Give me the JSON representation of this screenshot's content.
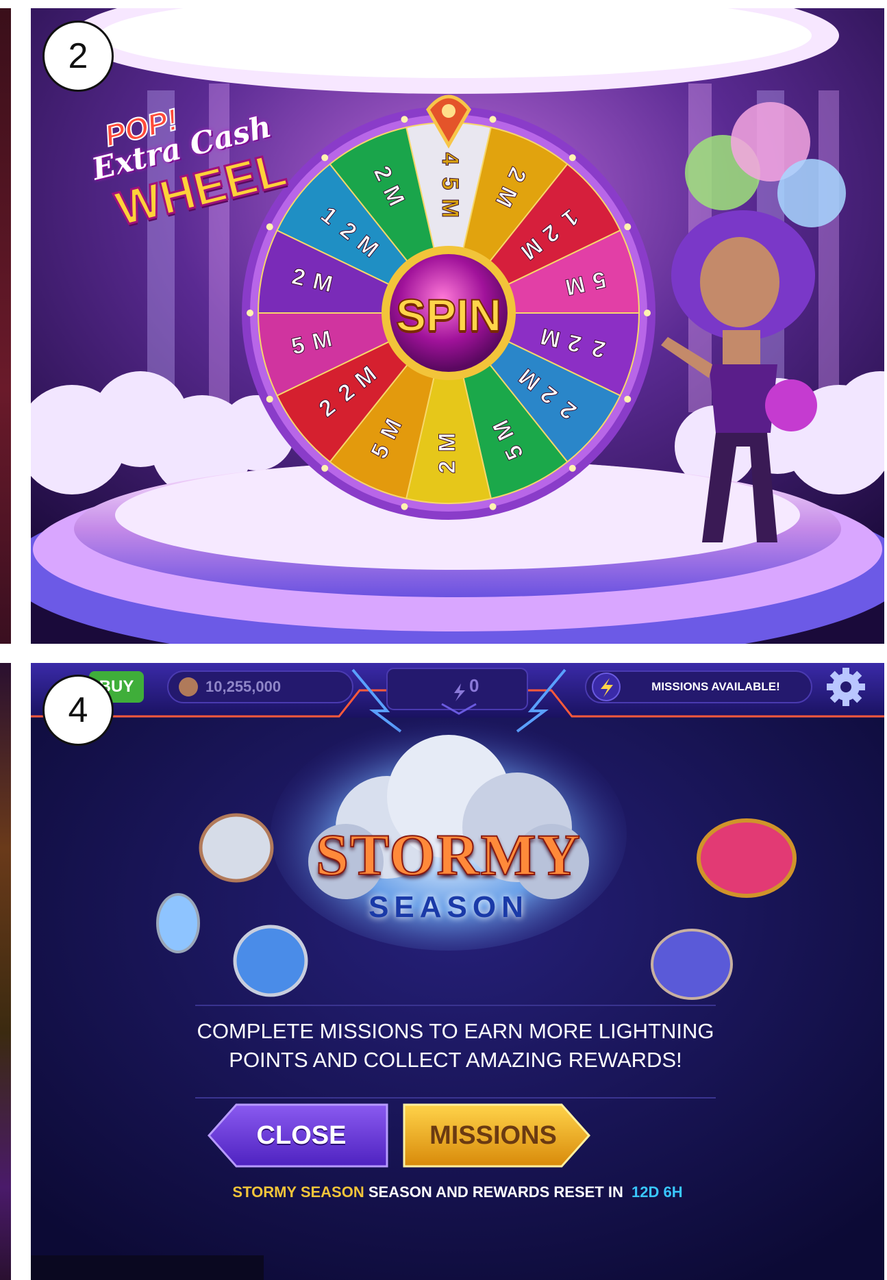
{
  "steps": {
    "top": "2",
    "bottom": "4"
  },
  "wheel_screen": {
    "logo": {
      "pop": "POP!",
      "extra_cash": "Extra Cash",
      "wheel": "WHEEL"
    },
    "spin_label": "SPIN",
    "segments": [
      {
        "label": "4\n5\nM",
        "color": "#e9e7f0",
        "text_color": "#d6a011"
      },
      {
        "label": "2\nM",
        "color": "#e1a30e",
        "text_color": "#ffffff"
      },
      {
        "label": "1\n2\nM",
        "color": "#d61f3c",
        "text_color": "#ffffff"
      },
      {
        "label": "5\nM",
        "color": "#e23fa6",
        "text_color": "#ffffff"
      },
      {
        "label": "2\n2\nM",
        "color": "#8c2fc5",
        "text_color": "#ffffff"
      },
      {
        "label": "2\n2\nM",
        "color": "#2a86c9",
        "text_color": "#ffffff"
      },
      {
        "label": "5\nM",
        "color": "#1ba84a",
        "text_color": "#ffffff"
      },
      {
        "label": "2\nM",
        "color": "#e6c71a",
        "text_color": "#ffffff"
      },
      {
        "label": "5\nM",
        "color": "#e39a0d",
        "text_color": "#ffffff"
      },
      {
        "label": "2\n2\nM",
        "color": "#d5202f",
        "text_color": "#ffffff"
      },
      {
        "label": "5\nM",
        "color": "#d0349f",
        "text_color": "#ffffff"
      },
      {
        "label": "2\nM",
        "color": "#7a2bb8",
        "text_color": "#ffffff"
      },
      {
        "label": "1\n2\nM",
        "color": "#1f8fc4",
        "text_color": "#ffffff"
      },
      {
        "label": "2\nM",
        "color": "#1aa54b",
        "text_color": "#ffffff"
      }
    ]
  },
  "missions_screen": {
    "topbar": {
      "buy_label": "BUY",
      "coin_balance": "10,255,000",
      "lightning_count": "0",
      "missions_available": "MISSIONS AVAILABLE!"
    },
    "title": {
      "line1": "STORMY",
      "line2": "SEASON"
    },
    "description": {
      "line1": "COMPLETE MISSIONS TO EARN MORE LIGHTNING",
      "line2": "POINTS AND COLLECT AMAZING REWARDS!"
    },
    "close_label": "CLOSE",
    "missions_label": "MISSIONS",
    "footer": {
      "season_name": "STORMY SEASON",
      "middle": "SEASON AND REWARDS RESET IN",
      "time_left": "12D 6H"
    }
  },
  "colors": {
    "gold": "#f2c43a",
    "cyan": "#39c6ff",
    "purple": "#6b3ad6"
  }
}
